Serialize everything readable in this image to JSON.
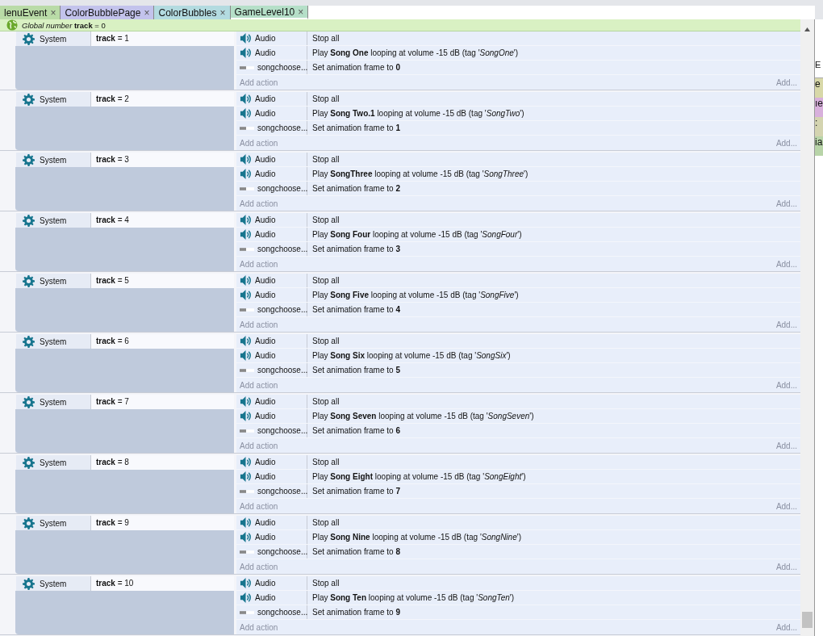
{
  "tabs": [
    {
      "label": "lenuEvent",
      "close": "×",
      "color": "#b9dba7",
      "selected": false
    },
    {
      "label": "ColorBubblePage",
      "close": "×",
      "color": "#c3c3ec",
      "selected": false
    },
    {
      "label": "ColorBubbles",
      "close": "×",
      "color": "#b3dbe0",
      "selected": false
    },
    {
      "label": "GameLevel10",
      "close": "×",
      "color": "#b5dfc8",
      "selected": true
    }
  ],
  "global_variable": "*Global number* **track** = 0",
  "events": [
    {
      "object": "System",
      "condition": "**track** = 1",
      "actions": [
        {
          "kind": "audio",
          "object": "Audio",
          "text": "Stop all"
        },
        {
          "kind": "audio",
          "object": "Audio",
          "text": "Play **Song One** looping at volume -15 dB (tag '*SongOne*')"
        },
        {
          "kind": "sprite",
          "object": "songchoose...",
          "text": "Set animation frame to **0**"
        }
      ],
      "add_action": "Add action",
      "add_hint": "Add..."
    },
    {
      "object": "System",
      "condition": "**track** = 2",
      "actions": [
        {
          "kind": "audio",
          "object": "Audio",
          "text": "Stop all"
        },
        {
          "kind": "audio",
          "object": "Audio",
          "text": "Play **Song Two.1** looping at volume -15 dB (tag '*SongTwo*')"
        },
        {
          "kind": "sprite",
          "object": "songchoose...",
          "text": "Set animation frame to **1**"
        }
      ],
      "add_action": "Add action",
      "add_hint": "Add..."
    },
    {
      "object": "System",
      "condition": "**track** = 3",
      "actions": [
        {
          "kind": "audio",
          "object": "Audio",
          "text": "Stop all"
        },
        {
          "kind": "audio",
          "object": "Audio",
          "text": "Play **SongThree** looping at volume -15 dB (tag '*SongThree*')"
        },
        {
          "kind": "sprite",
          "object": "songchoose...",
          "text": "Set animation frame to **2**"
        }
      ],
      "add_action": "Add action",
      "add_hint": "Add..."
    },
    {
      "object": "System",
      "condition": "**track** = 4",
      "actions": [
        {
          "kind": "audio",
          "object": "Audio",
          "text": "Stop all"
        },
        {
          "kind": "audio",
          "object": "Audio",
          "text": "Play **Song Four** looping at volume -15 dB (tag '*SongFour*')"
        },
        {
          "kind": "sprite",
          "object": "songchoose...",
          "text": "Set animation frame to **3**"
        }
      ],
      "add_action": "Add action",
      "add_hint": "Add..."
    },
    {
      "object": "System",
      "condition": "**track** = 5",
      "actions": [
        {
          "kind": "audio",
          "object": "Audio",
          "text": "Stop all"
        },
        {
          "kind": "audio",
          "object": "Audio",
          "text": "Play **Song Five** looping at volume -15 dB (tag '*SongFive*')"
        },
        {
          "kind": "sprite",
          "object": "songchoose...",
          "text": "Set animation frame to **4**"
        }
      ],
      "add_action": "Add action",
      "add_hint": "Add..."
    },
    {
      "object": "System",
      "condition": "**track** = 6",
      "actions": [
        {
          "kind": "audio",
          "object": "Audio",
          "text": "Stop all"
        },
        {
          "kind": "audio",
          "object": "Audio",
          "text": "Play **Song Six** looping at volume -15 dB (tag '*SongSix*')"
        },
        {
          "kind": "sprite",
          "object": "songchoose...",
          "text": "Set animation frame to **5**"
        }
      ],
      "add_action": "Add action",
      "add_hint": "Add..."
    },
    {
      "object": "System",
      "condition": "**track** = 7",
      "actions": [
        {
          "kind": "audio",
          "object": "Audio",
          "text": "Stop all"
        },
        {
          "kind": "audio",
          "object": "Audio",
          "text": "Play **Song Seven** looping at volume -15 dB (tag '*SongSeven*')"
        },
        {
          "kind": "sprite",
          "object": "songchoose...",
          "text": "Set animation frame to **6**"
        }
      ],
      "add_action": "Add action",
      "add_hint": "Add..."
    },
    {
      "object": "System",
      "condition": "**track** = 8",
      "actions": [
        {
          "kind": "audio",
          "object": "Audio",
          "text": "Stop all"
        },
        {
          "kind": "audio",
          "object": "Audio",
          "text": "Play **Song Eight** looping at volume -15 dB (tag '*SongEight*')"
        },
        {
          "kind": "sprite",
          "object": "songchoose...",
          "text": "Set animation frame to **7**"
        }
      ],
      "add_action": "Add action",
      "add_hint": "Add..."
    },
    {
      "object": "System",
      "condition": "**track** = 9",
      "actions": [
        {
          "kind": "audio",
          "object": "Audio",
          "text": "Stop all"
        },
        {
          "kind": "audio",
          "object": "Audio",
          "text": "Play **Song Nine** looping at volume -15 dB (tag '*SongNine*')"
        },
        {
          "kind": "sprite",
          "object": "songchoose...",
          "text": "Set animation frame to **8**"
        }
      ],
      "add_action": "Add action",
      "add_hint": "Add..."
    },
    {
      "object": "System",
      "condition": "**track** = 10",
      "actions": [
        {
          "kind": "audio",
          "object": "Audio",
          "text": "Stop all"
        },
        {
          "kind": "audio",
          "object": "Audio",
          "text": "Play **Song Ten** looping at volume -15 dB (tag '*SongTen*')"
        },
        {
          "kind": "sprite",
          "object": "songchoose...",
          "text": "Set animation frame to **9**"
        }
      ],
      "add_action": "Add action",
      "add_hint": "Add..."
    }
  ],
  "side_panel": {
    "heading": "E",
    "items": [
      {
        "label": "e",
        "color": "#d8d8a8"
      },
      {
        "label": "ıe",
        "color": "#d8b0dc"
      },
      {
        "label": ":",
        "color": "#d4d4b0"
      },
      {
        "label": "ia",
        "color": "#b8d4a8"
      }
    ]
  }
}
